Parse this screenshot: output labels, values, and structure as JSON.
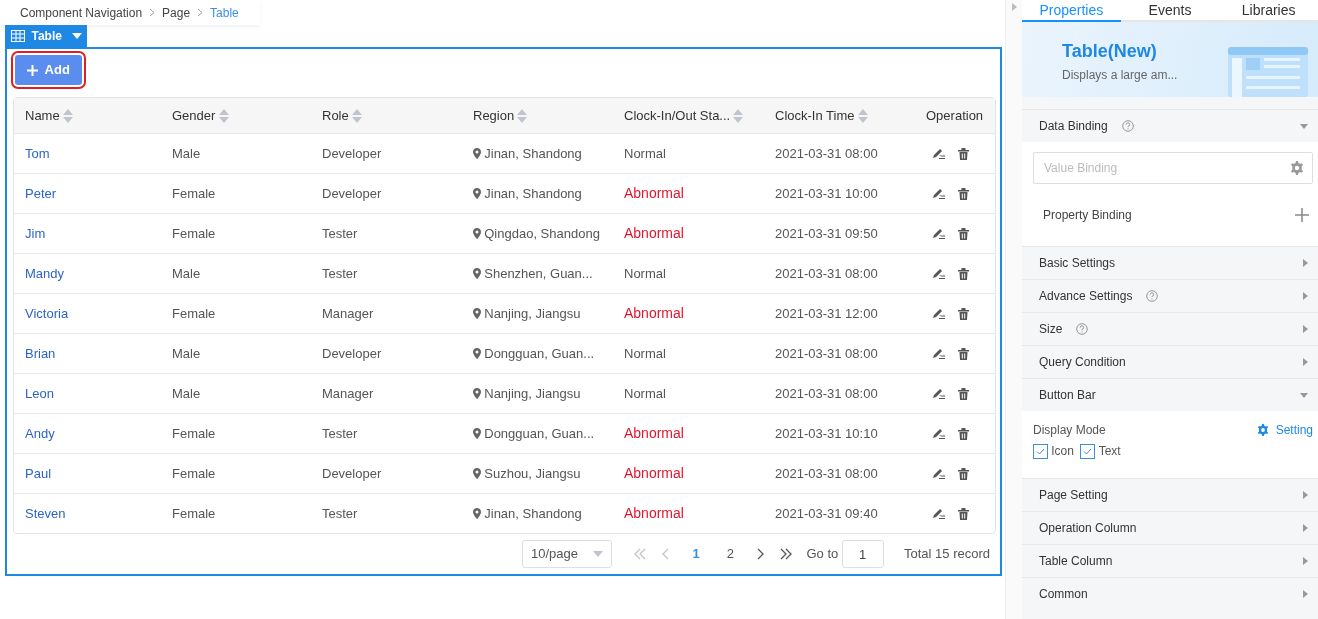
{
  "breadcrumb": [
    {
      "label": "Component Navigation",
      "selected": false
    },
    {
      "label": "Page",
      "selected": false
    },
    {
      "label": "Table",
      "selected": true
    }
  ],
  "component_tag": {
    "label": "Table"
  },
  "add_button": {
    "label": "Add"
  },
  "table": {
    "columns": [
      {
        "label": "Name",
        "sortable": true
      },
      {
        "label": "Gender",
        "sortable": true
      },
      {
        "label": "Role",
        "sortable": true
      },
      {
        "label": "Region",
        "sortable": true
      },
      {
        "label": "Clock-In/Out Sta...",
        "sortable": true
      },
      {
        "label": "Clock-In Time",
        "sortable": true
      },
      {
        "label": "Operation",
        "sortable": false
      }
    ],
    "rows": [
      {
        "name": "Tom",
        "gender": "Male",
        "role": "Developer",
        "region": "Jinan, Shandong",
        "status": "Normal",
        "abnormal": false,
        "time": "2021-03-31 08:00"
      },
      {
        "name": "Peter",
        "gender": "Female",
        "role": "Developer",
        "region": "Jinan, Shandong",
        "status": "Abnormal",
        "abnormal": true,
        "time": "2021-03-31 10:00"
      },
      {
        "name": "Jim",
        "gender": "Female",
        "role": "Tester",
        "region": "Qingdao, Shandong",
        "status": "Abnormal",
        "abnormal": true,
        "time": "2021-03-31 09:50"
      },
      {
        "name": "Mandy",
        "gender": "Male",
        "role": "Tester",
        "region": "Shenzhen, Guan...",
        "status": "Normal",
        "abnormal": false,
        "time": "2021-03-31 08:00"
      },
      {
        "name": "Victoria",
        "gender": "Female",
        "role": "Manager",
        "region": "Nanjing, Jiangsu",
        "status": "Abnormal",
        "abnormal": true,
        "time": "2021-03-31 12:00"
      },
      {
        "name": "Brian",
        "gender": "Male",
        "role": "Developer",
        "region": "Dongguan, Guan...",
        "status": "Normal",
        "abnormal": false,
        "time": "2021-03-31 08:00"
      },
      {
        "name": "Leon",
        "gender": "Male",
        "role": "Manager",
        "region": "Nanjing, Jiangsu",
        "status": "Normal",
        "abnormal": false,
        "time": "2021-03-31 08:00"
      },
      {
        "name": "Andy",
        "gender": "Female",
        "role": "Tester",
        "region": "Dongguan, Guan...",
        "status": "Abnormal",
        "abnormal": true,
        "time": "2021-03-31 10:10"
      },
      {
        "name": "Paul",
        "gender": "Female",
        "role": "Developer",
        "region": "Suzhou, Jiangsu",
        "status": "Abnormal",
        "abnormal": true,
        "time": "2021-03-31 08:00"
      },
      {
        "name": "Steven",
        "gender": "Female",
        "role": "Tester",
        "region": "Jinan, Shandong",
        "status": "Abnormal",
        "abnormal": true,
        "time": "2021-03-31 09:40"
      }
    ]
  },
  "pagination": {
    "page_size": "10/page",
    "pages": [
      {
        "label": "1",
        "selected": true
      },
      {
        "label": "2",
        "selected": false
      }
    ],
    "goto_label": "Go to",
    "goto_value": "1",
    "total": "Total 15 record"
  },
  "panel": {
    "tabs": [
      {
        "label": "Properties",
        "selected": true
      },
      {
        "label": "Events",
        "selected": false
      },
      {
        "label": "Libraries",
        "selected": false
      }
    ],
    "banner": {
      "title": "Table(New)",
      "subtitle": "Displays a large am..."
    },
    "sections": [
      {
        "label": "Data Binding",
        "help": true,
        "expanded": true,
        "content": {
          "kind": "binding",
          "placeholder": "Value Binding",
          "property_label": "Property Binding"
        }
      },
      {
        "label": "Basic Settings",
        "help": false,
        "expanded": false
      },
      {
        "label": "Advance Settings",
        "help": true,
        "expanded": false
      },
      {
        "label": "Size",
        "help": true,
        "expanded": false
      },
      {
        "label": "Query Condition",
        "help": false,
        "expanded": false
      },
      {
        "label": "Button Bar",
        "help": false,
        "expanded": true,
        "content": {
          "kind": "display_mode",
          "label": "Display Mode",
          "link": "Setting",
          "options": [
            {
              "label": "Icon",
              "checked": true
            },
            {
              "label": "Text",
              "checked": true
            }
          ]
        }
      },
      {
        "label": "Page Setting",
        "help": false,
        "expanded": false
      },
      {
        "label": "Operation Column",
        "help": false,
        "expanded": false
      },
      {
        "label": "Table Column",
        "help": false,
        "expanded": false
      },
      {
        "label": "Common",
        "help": false,
        "expanded": false
      }
    ]
  }
}
